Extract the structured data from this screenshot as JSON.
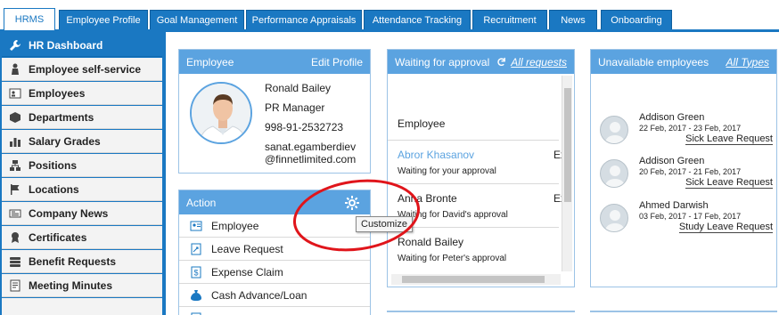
{
  "tabs": [
    {
      "label": "HRMS",
      "active": true
    },
    {
      "label": "Employee Profile"
    },
    {
      "label": "Goal Management"
    },
    {
      "label": "Performance Appraisals"
    },
    {
      "label": "Attendance Tracking"
    },
    {
      "label": "Recruitment"
    },
    {
      "label": "News"
    },
    {
      "label": "Onboarding"
    }
  ],
  "sidebar": {
    "items": [
      {
        "label": "HR Dashboard",
        "icon": "wrench-icon",
        "active": true
      },
      {
        "label": "Employee self-service",
        "icon": "person-icon"
      },
      {
        "label": "Employees",
        "icon": "id-card-icon"
      },
      {
        "label": "Departments",
        "icon": "cube-icon"
      },
      {
        "label": "Salary Grades",
        "icon": "bar-chart-icon"
      },
      {
        "label": "Positions",
        "icon": "org-chart-icon"
      },
      {
        "label": "Locations",
        "icon": "flag-icon"
      },
      {
        "label": "Company News",
        "icon": "newspaper-icon"
      },
      {
        "label": "Certificates",
        "icon": "ribbon-icon"
      },
      {
        "label": "Benefit Requests",
        "icon": "stack-icon"
      },
      {
        "label": "Meeting Minutes",
        "icon": "notes-icon"
      }
    ]
  },
  "employee_panel": {
    "title": "Employee",
    "edit_link": "Edit Profile",
    "name": "Ronald Bailey",
    "position": "PR Manager",
    "phone": "998-91-2532723",
    "email_line1": "sanat.egamberdiev",
    "email_line2": "@finnetlimited.com"
  },
  "action_panel": {
    "title": "Action",
    "items": [
      {
        "label": "Employee",
        "icon": "id-card-icon"
      },
      {
        "label": "Leave Request",
        "icon": "leave-icon"
      },
      {
        "label": "Expense Claim",
        "icon": "dollar-doc-icon"
      },
      {
        "label": "Cash Advance/Loan",
        "icon": "money-bag-icon"
      }
    ],
    "tooltip": "Customize"
  },
  "waiting_panel": {
    "title": "Waiting for approval",
    "all_link": "All requests",
    "column": "Employee",
    "items": [
      {
        "name": "Abror Khasanov",
        "status": "Waiting for your approval",
        "trail": "Ex",
        "highlight": true
      },
      {
        "name": "Anna Bronte",
        "status": "Waiting for David's approval",
        "trail": "Ex"
      },
      {
        "name": "Ronald Bailey",
        "status": "Waiting for Peter's approval",
        "trail": ""
      }
    ]
  },
  "unavailable_panel": {
    "title": "Unavailable employees",
    "all_link": "All Types",
    "items": [
      {
        "name": "Addison Green",
        "dates": "22 Feb, 2017 - 23 Feb, 2017",
        "type": "Sick Leave Request"
      },
      {
        "name": "Addison Green",
        "dates": "20 Feb, 2017 - 21 Feb, 2017",
        "type": "Sick Leave Request"
      },
      {
        "name": "Ahmed Darwish",
        "dates": "03 Feb, 2017 - 17 Feb, 2017",
        "type": "Study Leave Request"
      }
    ]
  },
  "colors": {
    "accent": "#1a78c2",
    "panel_header": "#5ba3e0",
    "annotation": "#e0151b"
  }
}
